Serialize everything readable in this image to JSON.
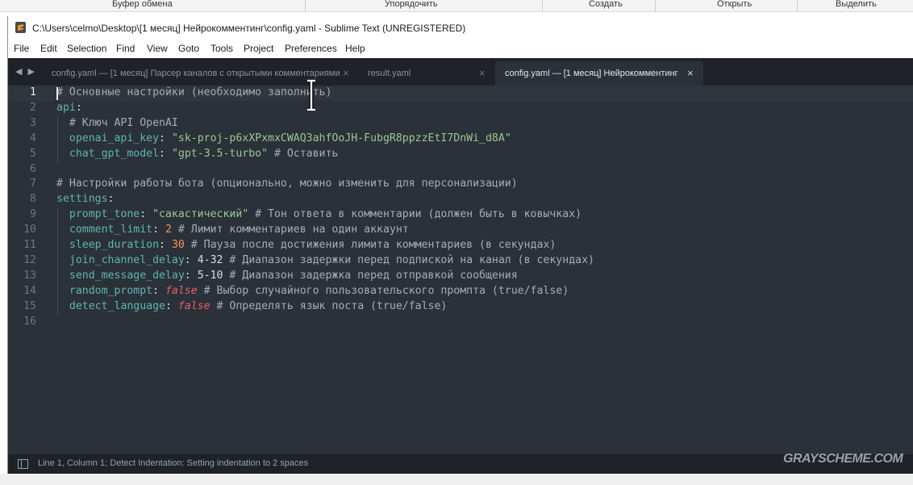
{
  "ribbon": {
    "items": [
      "Буфер обмена",
      "Упорядочить",
      "Создать",
      "Открыть",
      "Выделить"
    ]
  },
  "window": {
    "title": "C:\\Users\\celmo\\Desktop\\[1 месяц] Нейрокомментинг\\config.yaml - Sublime Text (UNREGISTERED)"
  },
  "menu": [
    "File",
    "Edit",
    "Selection",
    "Find",
    "View",
    "Goto",
    "Tools",
    "Project",
    "Preferences",
    "Help"
  ],
  "tabs": [
    {
      "label": "config.yaml — [1 месяц] Парсер каналов с открытыми комментариями",
      "active": false
    },
    {
      "label": "result.yaml",
      "active": false
    },
    {
      "label": "config.yaml — [1 месяц] Нейрокомментинг",
      "active": true
    }
  ],
  "tab_close_glyph": "×",
  "editor": {
    "current_line": 1,
    "lines": [
      {
        "n": "1",
        "tokens": [
          {
            "c": "com",
            "t": "# Основные настройки (необходимо заполнить)"
          }
        ]
      },
      {
        "n": "2",
        "tokens": [
          {
            "c": "key",
            "t": "api"
          },
          {
            "c": "txt",
            "t": ":"
          }
        ]
      },
      {
        "n": "3",
        "tokens": [
          {
            "c": "com",
            "t": "  # Ключ API OpenAI"
          }
        ]
      },
      {
        "n": "4",
        "tokens": [
          {
            "c": "key",
            "t": "  openai_api_key"
          },
          {
            "c": "txt",
            "t": ": "
          },
          {
            "c": "str",
            "t": "\"sk-proj-p6xXPxmxCWAQ3ahfOoJH-FubgR8ppzzEtI7DnWi_d8A\""
          }
        ]
      },
      {
        "n": "5",
        "tokens": [
          {
            "c": "key",
            "t": "  chat_gpt_model"
          },
          {
            "c": "txt",
            "t": ": "
          },
          {
            "c": "str",
            "t": "\"gpt-3.5-turbo\""
          },
          {
            "c": "com",
            "t": " # Оставить"
          }
        ]
      },
      {
        "n": "6",
        "tokens": []
      },
      {
        "n": "7",
        "tokens": [
          {
            "c": "com",
            "t": "# Настройки работы бота (опционально, можно изменить для персонализации)"
          }
        ]
      },
      {
        "n": "8",
        "tokens": [
          {
            "c": "key",
            "t": "settings"
          },
          {
            "c": "txt",
            "t": ":"
          }
        ]
      },
      {
        "n": "9",
        "tokens": [
          {
            "c": "key",
            "t": "  prompt_tone"
          },
          {
            "c": "txt",
            "t": ": "
          },
          {
            "c": "str",
            "t": "\"сакастический\""
          },
          {
            "c": "com",
            "t": " # Тон ответа в комментарии (должен быть в ковычках)"
          }
        ]
      },
      {
        "n": "10",
        "tokens": [
          {
            "c": "key",
            "t": "  comment_limit"
          },
          {
            "c": "txt",
            "t": ": "
          },
          {
            "c": "num",
            "t": "2"
          },
          {
            "c": "com",
            "t": " # Лимит комментариев на один аккаунт"
          }
        ]
      },
      {
        "n": "11",
        "tokens": [
          {
            "c": "key",
            "t": "  sleep_duration"
          },
          {
            "c": "txt",
            "t": ": "
          },
          {
            "c": "num",
            "t": "30"
          },
          {
            "c": "com",
            "t": " # Пауза после достижения лимита комментариев (в секундах)"
          }
        ]
      },
      {
        "n": "12",
        "tokens": [
          {
            "c": "key",
            "t": "  join_channel_delay"
          },
          {
            "c": "txt",
            "t": ": "
          },
          {
            "c": "txt",
            "t": "4-32"
          },
          {
            "c": "com",
            "t": " # Диапазон задержки перед подпиской на канал (в секундах)"
          }
        ]
      },
      {
        "n": "13",
        "tokens": [
          {
            "c": "key",
            "t": "  send_message_delay"
          },
          {
            "c": "txt",
            "t": ": "
          },
          {
            "c": "txt",
            "t": "5-10"
          },
          {
            "c": "com",
            "t": " # Диапазон задержка перед отправкой сообщения"
          }
        ]
      },
      {
        "n": "14",
        "tokens": [
          {
            "c": "key",
            "t": "  random_prompt"
          },
          {
            "c": "txt",
            "t": ": "
          },
          {
            "c": "kw",
            "t": "false"
          },
          {
            "c": "com",
            "t": " # Выбор случайного пользовательского промпта (true/false)"
          }
        ]
      },
      {
        "n": "15",
        "tokens": [
          {
            "c": "key",
            "t": "  detect_language"
          },
          {
            "c": "txt",
            "t": ": "
          },
          {
            "c": "kw",
            "t": "false"
          },
          {
            "c": "com",
            "t": " # Определять язык поста (true/false)"
          }
        ]
      },
      {
        "n": "16",
        "tokens": []
      }
    ]
  },
  "status": {
    "text": "Line 1, Column 1; Detect Indentation: Setting indentation to 2 spaces"
  },
  "watermark": "GRAYSCHEME.COM",
  "colors": {
    "editor_bg": "#2b3138",
    "tabbar_bg": "#1f2328",
    "comment": "#a6adb5",
    "key": "#5fb4b4",
    "string": "#99c794",
    "number": "#f99157",
    "boolean": "#ec5f67"
  }
}
